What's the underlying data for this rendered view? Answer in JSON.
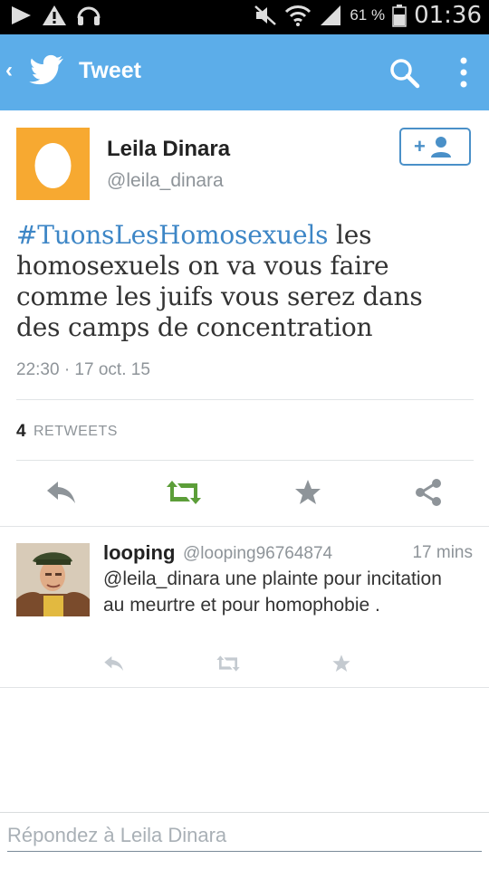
{
  "status_bar": {
    "battery_percent": "61 %",
    "time": "01:36",
    "icons": [
      "play-icon",
      "warning-icon",
      "headset-icon",
      "mute-icon",
      "wifi-icon",
      "signal-icon",
      "battery-icon"
    ]
  },
  "app_bar": {
    "title": "Tweet",
    "icons": [
      "back-icon",
      "twitter-bird-icon",
      "search-icon",
      "more-icon"
    ],
    "color": "#5cade9"
  },
  "tweet": {
    "author_name": "Leila Dinara",
    "author_handle": "@leila_dinara",
    "hashtag": "#TuonsLesHomosexuels",
    "text": " les homosexuels on va vous faire comme les juifs vous serez dans des camps de concentration",
    "timestamp": "22:30 · 17 oct. 15",
    "retweet_count": "4",
    "retweet_label": "RETWEETS",
    "follow_icon": "follow-user-icon",
    "avatar_color": "#f7a931"
  },
  "actions": [
    "reply-icon",
    "retweet-icon",
    "favorite-icon",
    "share-icon"
  ],
  "reply_tweet": {
    "author_name": "looping",
    "author_handle": "@looping96764874",
    "time": "17 mins",
    "text": "@leila_dinara  une plainte pour incitation au meurtre et pour homophobie ."
  },
  "compose": {
    "placeholder": "Répondez à Leila Dinara"
  },
  "colors": {
    "link": "#3d86c6",
    "retweet_green": "#5c9e39",
    "icon_gray": "#8e9499"
  }
}
